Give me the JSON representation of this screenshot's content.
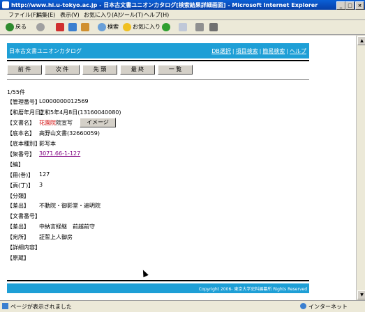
{
  "window": {
    "title": "http://www.hi.u-tokyo.ac.jp - 日本古文書ユニオンカタログ[検索結果詳細画面] - Microsoft Internet Explorer"
  },
  "menu": [
    "ファイル(F)",
    "編集(E)",
    "表示(V)",
    "お気に入り(A)",
    "ツール(T)",
    "ヘルプ(H)"
  ],
  "toolbar": {
    "back": "戻る",
    "search": "検索",
    "favorites": "お気に入り"
  },
  "header": {
    "site": "日本古文書ユニオンカタログ",
    "links": [
      "DB選択",
      "項目検索",
      "簡易検索",
      "ヘルプ"
    ]
  },
  "nav": [
    "前 件",
    "次 件",
    "先 頭",
    "最 終",
    "一 覧"
  ],
  "record": {
    "counter": "1/55件",
    "image_button": "イメージ",
    "fields": [
      {
        "label": "【管理番号】",
        "value": "L0000000012569"
      },
      {
        "label": "【和暦年月日】",
        "value": "正和5年4月8日(13160040080)"
      },
      {
        "label": "【文書名】",
        "value_red": "花園院",
        "value_rest": "院宣写"
      },
      {
        "label": "【底本名】",
        "value": "高野山文書(32660059)"
      },
      {
        "label": "【底本種別】",
        "value": "影写本"
      },
      {
        "label": "【架番号】",
        "value": "3071.66-1-127"
      },
      {
        "label": "【編】",
        "value": ""
      },
      {
        "label": "【冊(巻)】",
        "value": "127"
      },
      {
        "label": "【頁(丁)】",
        "value": "3"
      },
      {
        "label": "【分類】",
        "value": ""
      },
      {
        "label": "【差出】",
        "value": "不動院・御影堂・遍明院"
      },
      {
        "label": "【文書番号】",
        "value": ""
      },
      {
        "label": "【差出】",
        "value": "中納言経継　前越前守"
      },
      {
        "label": "【宛所】",
        "value": "証誓上人御房"
      },
      {
        "label": "【詳細内容】",
        "value": ""
      },
      {
        "label": "【原蔵】",
        "value": ""
      }
    ]
  },
  "footer": {
    "copyright": "Copyright 2006- 東京大学史料編纂所 Rights Reserved"
  },
  "status": {
    "text": "ページが表示されました",
    "zone": "インターネット"
  }
}
